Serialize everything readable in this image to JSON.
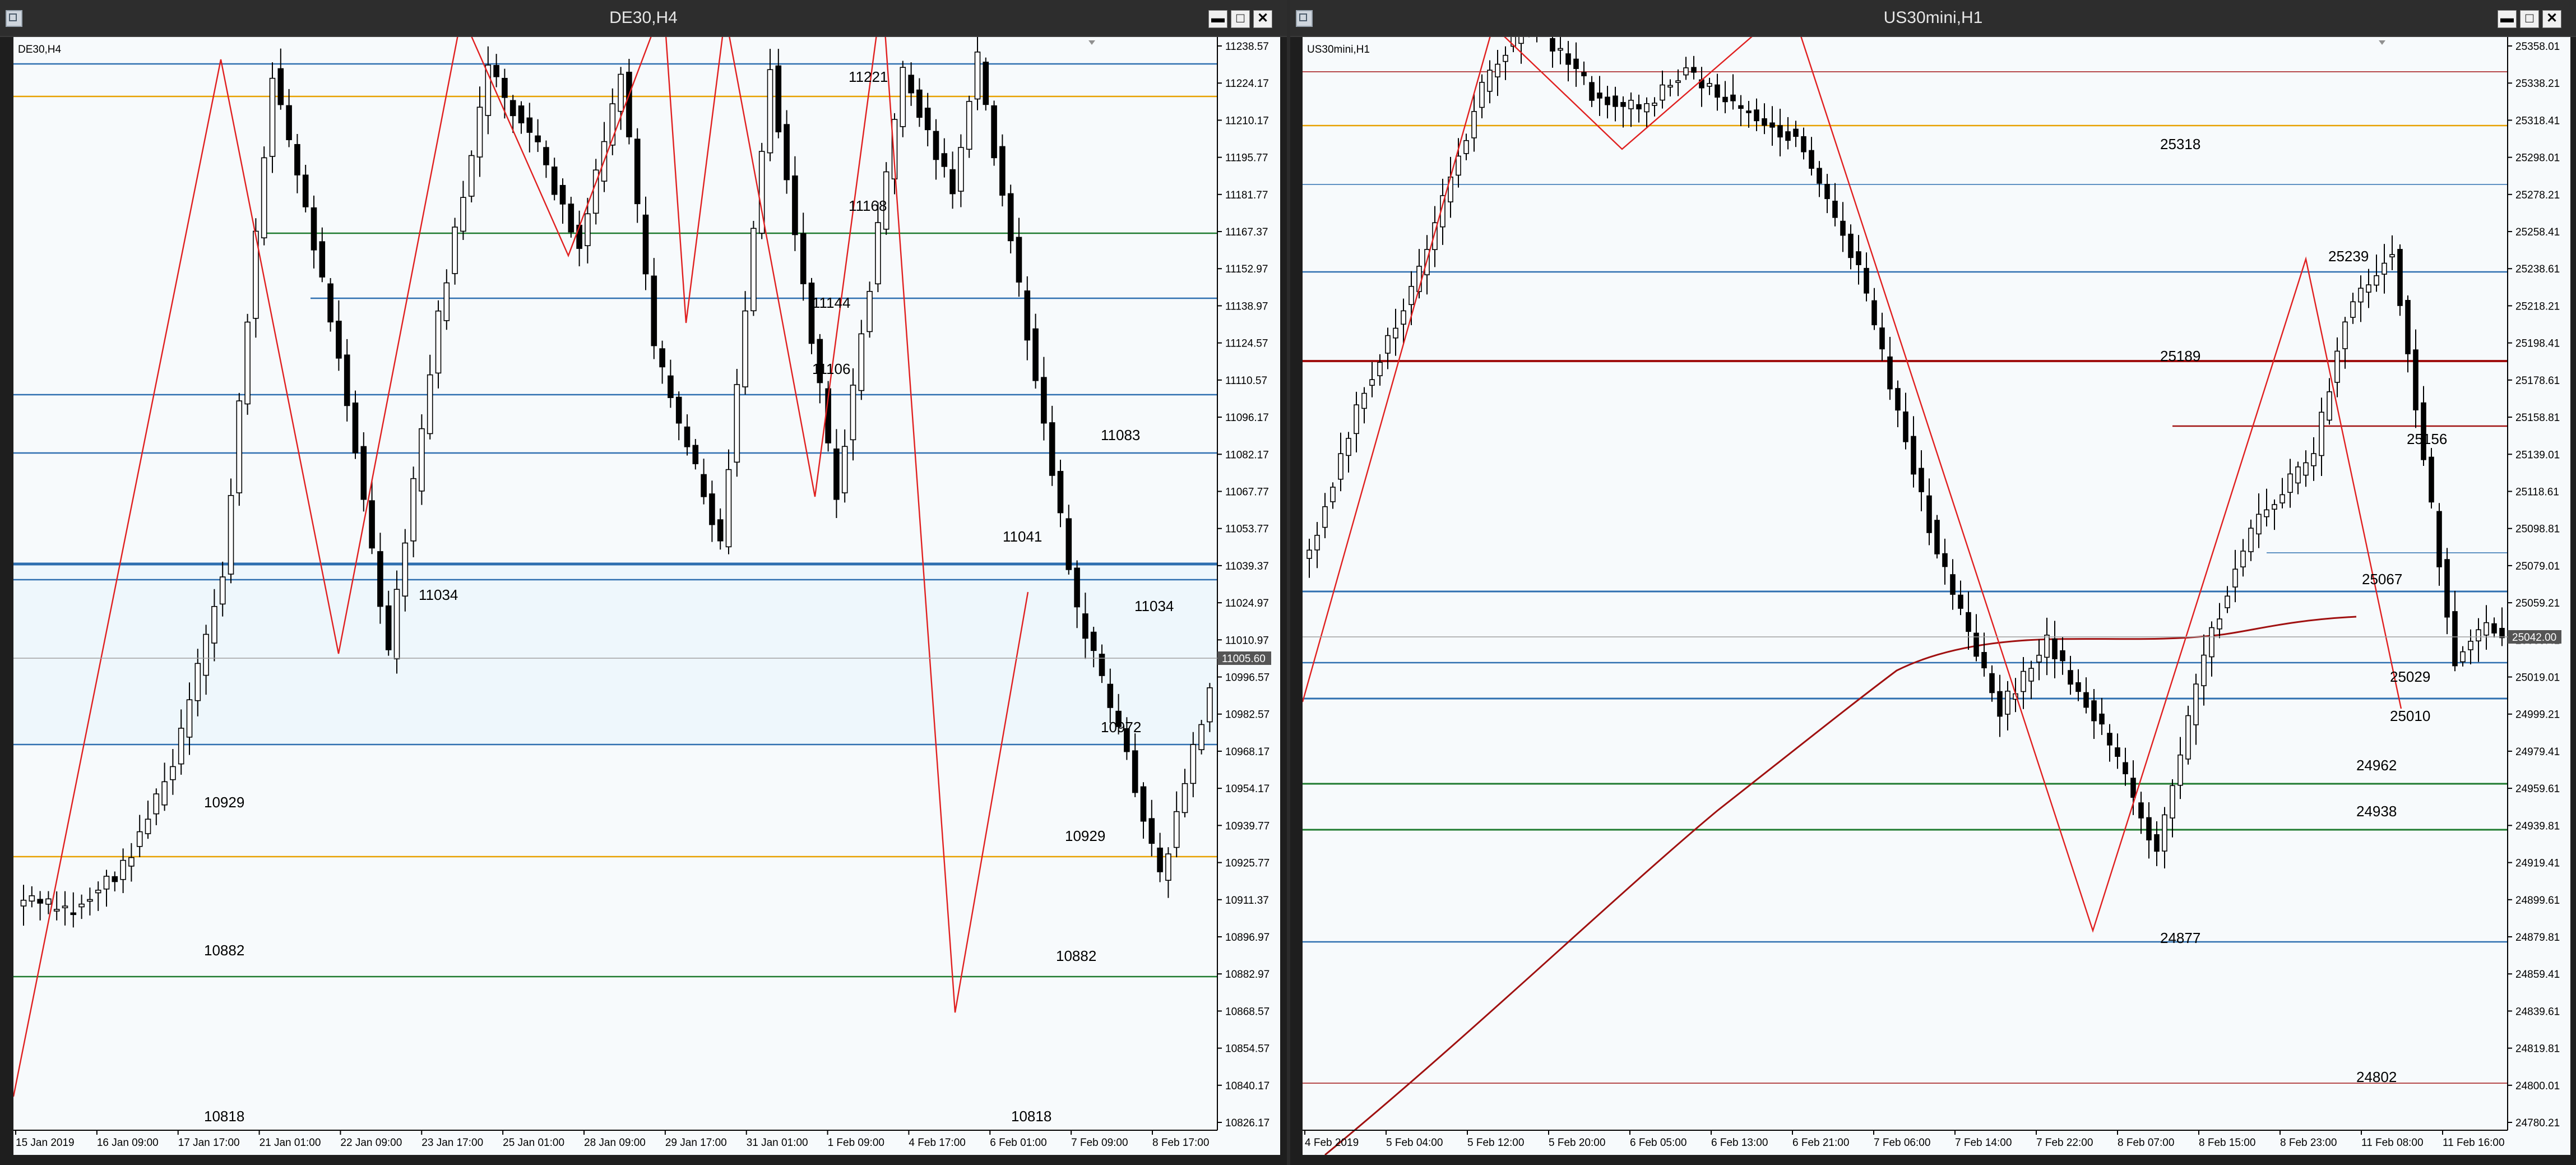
{
  "windows": [
    {
      "title": "DE30,H4",
      "symbol_label": "DE30,H4",
      "buttons": {
        "minimize": "▬",
        "maximize": "□",
        "close": "✕"
      },
      "price_axis": [
        "11238.57",
        "11224.17",
        "11210.17",
        "11195.77",
        "11181.77",
        "11167.37",
        "11152.97",
        "11138.97",
        "11124.57",
        "11110.57",
        "11096.17",
        "11082.17",
        "11067.77",
        "11053.77",
        "11039.37",
        "11024.97",
        "11010.97",
        "10996.57",
        "10982.57",
        "10968.17",
        "10954.17",
        "10939.77",
        "10925.77",
        "10911.37",
        "10896.97",
        "10882.97",
        "10868.57",
        "10854.57",
        "10840.17",
        "10826.17"
      ],
      "current_price": "11005.60",
      "time_axis": [
        "15 Jan 2019",
        "16 Jan 09:00",
        "17 Jan 17:00",
        "21 Jan 01:00",
        "22 Jan 09:00",
        "23 Jan 17:00",
        "25 Jan 01:00",
        "28 Jan 09:00",
        "29 Jan 17:00",
        "31 Jan 01:00",
        "1 Feb 09:00",
        "4 Feb 17:00",
        "6 Feb 01:00",
        "7 Feb 09:00",
        "8 Feb 17:00"
      ],
      "level_labels": [
        "11221",
        "11168",
        "11144",
        "11106",
        "11083",
        "11041",
        "11034",
        "11034",
        "10972",
        "10929",
        "10929",
        "10882",
        "10882",
        "10818",
        "10818"
      ],
      "colors": {
        "bg": "#f7fafc",
        "grid": "#cfd9e3",
        "blue_level": "#2e6fb0",
        "orange_level": "#e8a000",
        "green_level": "#1e7a2e",
        "zigzag": "#e02020",
        "candle": "#000000",
        "zone": "#eef7fc"
      }
    },
    {
      "title": "US30mini,H1",
      "symbol_label": "US30mini,H1",
      "buttons": {
        "minimize": "▬",
        "maximize": "□",
        "close": "✕"
      },
      "price_axis": [
        "25358.01",
        "25338.21",
        "25318.41",
        "25298.01",
        "25278.21",
        "25258.41",
        "25238.61",
        "25218.21",
        "25198.41",
        "25178.61",
        "25158.81",
        "25139.01",
        "25118.61",
        "25098.81",
        "25079.01",
        "25059.21",
        "25039.41",
        "25019.01",
        "24999.21",
        "24979.41",
        "24959.61",
        "24939.81",
        "24919.41",
        "24899.61",
        "24879.81",
        "24859.41",
        "24839.61",
        "24819.81",
        "24800.01",
        "24780.21"
      ],
      "current_price": "25042.00",
      "time_axis": [
        "4 Feb 2019",
        "5 Feb 04:00",
        "5 Feb 12:00",
        "5 Feb 20:00",
        "6 Feb 05:00",
        "6 Feb 13:00",
        "6 Feb 21:00",
        "7 Feb 06:00",
        "7 Feb 14:00",
        "7 Feb 22:00",
        "8 Feb 07:00",
        "8 Feb 15:00",
        "8 Feb 23:00",
        "11 Feb 08:00",
        "11 Feb 16:00"
      ],
      "level_labels": [
        "25318",
        "25239",
        "25189",
        "25156",
        "25067",
        "25029",
        "25010",
        "24962",
        "24938",
        "24877",
        "24802"
      ],
      "colors": {
        "bg": "#f7fafc",
        "grid": "#cfd9e3",
        "blue_level": "#2e6fb0",
        "orange_level": "#e8a000",
        "green_level": "#1e7a2e",
        "dark_red_level": "#a01010",
        "zigzag": "#e02020",
        "candle": "#000000",
        "ma": "#a01010"
      }
    }
  ]
}
